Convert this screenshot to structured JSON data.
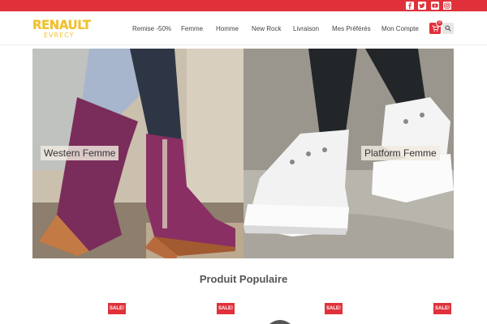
{
  "social": {
    "icons": [
      "facebook-icon",
      "twitter-icon",
      "youtube-icon",
      "instagram-icon"
    ]
  },
  "brand": {
    "name": "RENAULT",
    "sub": "EVRECY"
  },
  "nav": {
    "items": [
      "Remise -50%",
      "Femme",
      "Homme",
      "New Rock",
      "Livraison",
      "Mes Préférés",
      "Mon Compte"
    ]
  },
  "cart": {
    "count": "0"
  },
  "banners": [
    {
      "label": "Western Femme"
    },
    {
      "label": "Platform Femme"
    }
  ],
  "popular": {
    "title": "Produit Populaire",
    "badges": [
      "SALE!",
      "SALE!",
      "SALE!",
      "SALE!"
    ]
  },
  "colors": {
    "accent": "#e0313b",
    "logo": "#f2c12e"
  }
}
